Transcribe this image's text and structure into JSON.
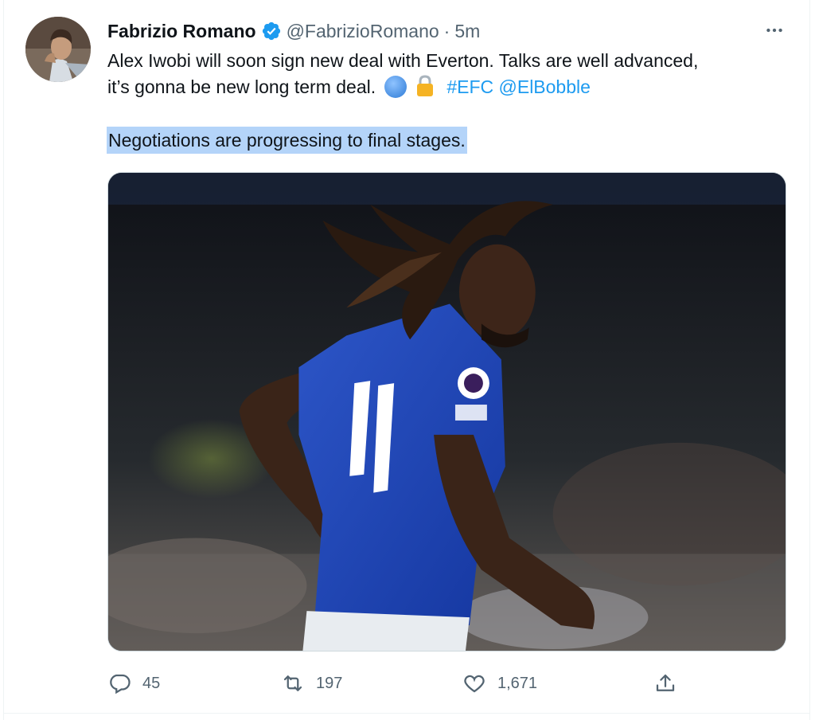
{
  "tweet": {
    "display_name": "Fabrizio Romano",
    "handle": "@FabrizioRomano",
    "separator": "·",
    "time": "5m",
    "text_line1": "Alex Iwobi will soon sign new deal with Everton. Talks are well advanced,",
    "text_line2_prefix": "it’s gonna be new long term deal.",
    "hashtag": "#EFC",
    "mention": "@ElBobble",
    "highlighted_text": "Negotiations are progressing to final stages.",
    "icons": {
      "verified": "verified-badge-icon",
      "more": "more-dots-icon",
      "emoji1": "blue-circle-emoji",
      "emoji2": "lock-emoji"
    },
    "colors": {
      "link": "#1d9bf0",
      "secondary_text": "#536471",
      "highlight": "#b4d4f9"
    }
  },
  "actions": {
    "reply_count": "45",
    "retweet_count": "197",
    "like_count": "1,671"
  }
}
